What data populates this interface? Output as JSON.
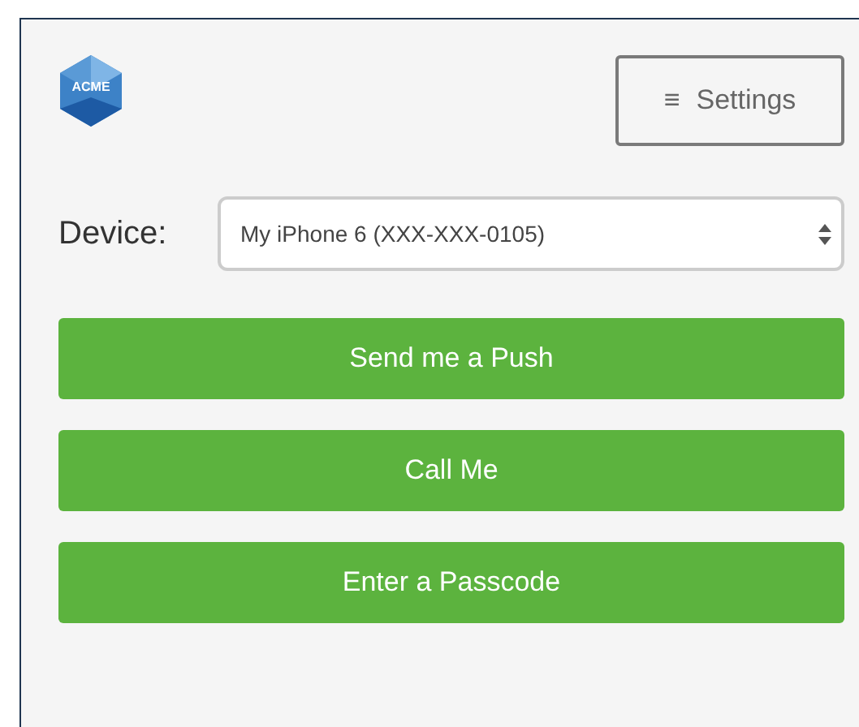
{
  "logo": {
    "text": "ACME"
  },
  "settings_button": {
    "icon": "≡",
    "label": "Settings"
  },
  "device": {
    "label": "Device:",
    "value": "My iPhone 6 (XXX-XXX-0105)"
  },
  "actions": [
    {
      "label": "Send me a Push"
    },
    {
      "label": "Call Me"
    },
    {
      "label": "Enter a Passcode"
    }
  ]
}
